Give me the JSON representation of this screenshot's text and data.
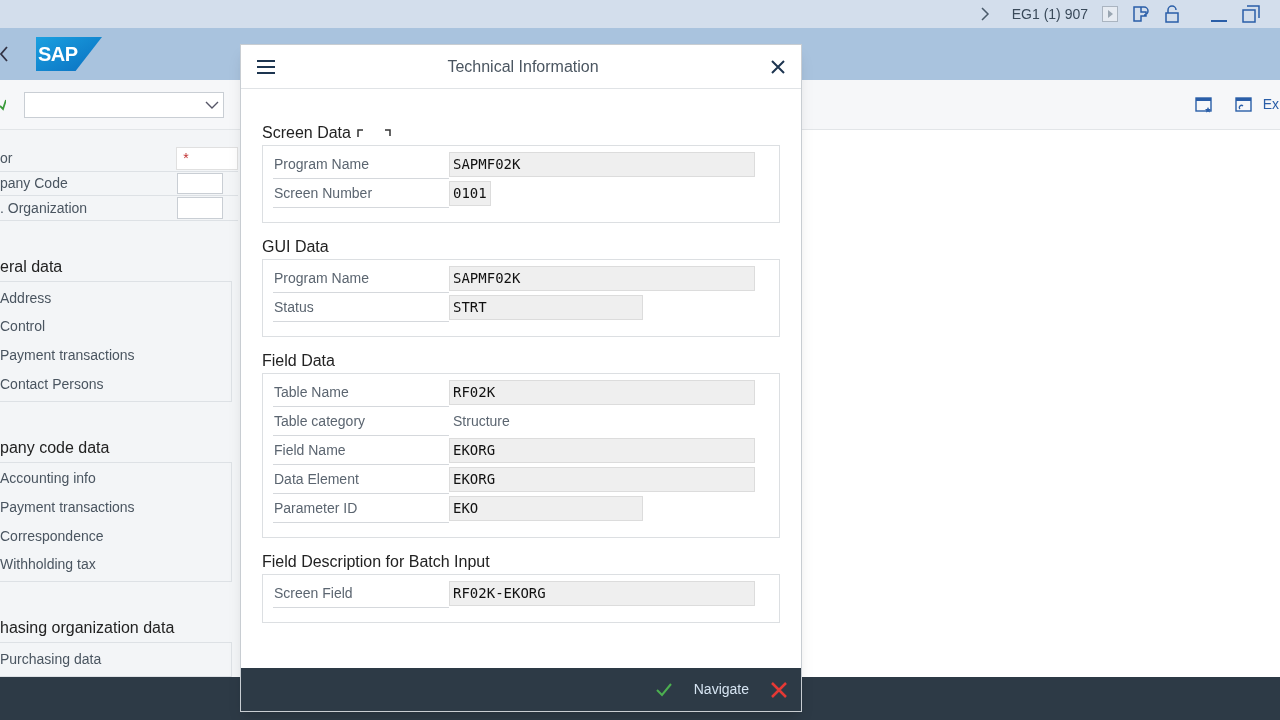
{
  "top_bar": {
    "system": "EG1 (1) 907"
  },
  "header": {
    "logo": "SAP"
  },
  "toolbar": {
    "right_text": "Ex"
  },
  "form": [
    {
      "label": "or",
      "required": true,
      "marker": "*"
    },
    {
      "label": "pany Code",
      "required": false
    },
    {
      "label": ". Organization",
      "required": false
    }
  ],
  "sections": [
    {
      "title": "eral data",
      "items": [
        "Address",
        "Control",
        "Payment transactions",
        "Contact Persons"
      ]
    },
    {
      "title": "pany code data",
      "items": [
        "Accounting info",
        "Payment transactions",
        "Correspondence",
        "Withholding tax"
      ]
    },
    {
      "title": "hasing organization data",
      "items": [
        "Purchasing data"
      ]
    }
  ],
  "dialog": {
    "title": "Technical Information",
    "groups": [
      {
        "title": "Screen Data",
        "rows": [
          {
            "label": "Program Name",
            "value": "SAPMF02K",
            "kind": "wide"
          },
          {
            "label": "Screen Number",
            "value": "0101",
            "kind": "narrow"
          }
        ]
      },
      {
        "title": "GUI Data",
        "rows": [
          {
            "label": "Program Name",
            "value": "SAPMF02K",
            "kind": "wide"
          },
          {
            "label": "Status",
            "value": "STRT",
            "kind": "medium"
          }
        ]
      },
      {
        "title": "Field Data",
        "rows": [
          {
            "label": "Table Name",
            "value": "RF02K",
            "kind": "wide"
          },
          {
            "label": "Table category",
            "value": "Structure",
            "kind": "plain"
          },
          {
            "label": "Field Name",
            "value": "EKORG",
            "kind": "wide"
          },
          {
            "label": "Data Element",
            "value": "EKORG",
            "kind": "wide"
          },
          {
            "label": "Parameter ID",
            "value": "EKO",
            "kind": "medium"
          }
        ]
      },
      {
        "title": "Field Description for Batch Input",
        "rows": [
          {
            "label": "Screen Field",
            "value": "RF02K-EKORG",
            "kind": "wide"
          }
        ]
      }
    ],
    "footer": {
      "action": "Navigate"
    }
  }
}
